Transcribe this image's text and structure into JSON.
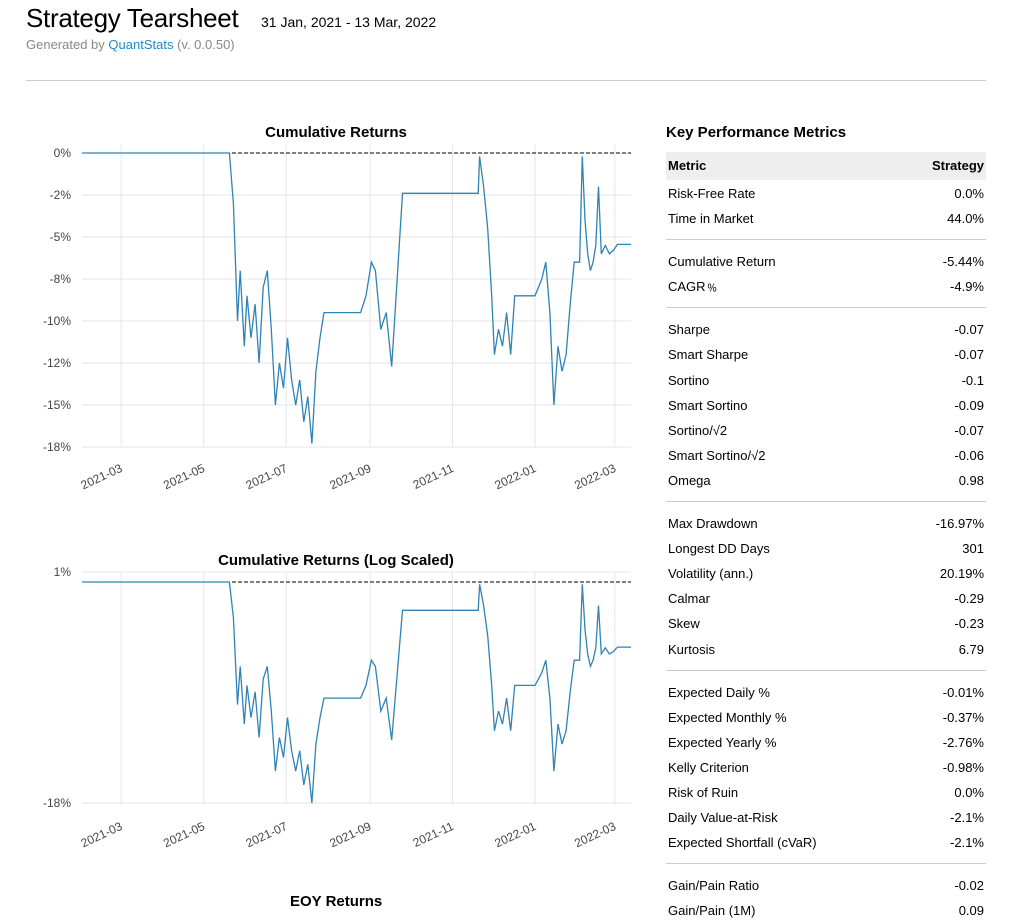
{
  "header": {
    "title": "Strategy Tearsheet",
    "date_range": "31 Jan, 2021 - 13 Mar, 2022",
    "generated_prefix": "Generated by",
    "generated_link": "QuantStats",
    "generated_version": "(v. 0.0.50)"
  },
  "colors": {
    "line": "#2f83b5",
    "link": "#1f8bc2",
    "header_bg": "#eeeeee"
  },
  "chart_data": [
    {
      "type": "line",
      "title": "Cumulative Returns",
      "x_ticks": [
        "2021-03",
        "2021-05",
        "2021-07",
        "2021-09",
        "2021-11",
        "2022-01",
        "2022-03"
      ],
      "y_ticks": [
        "0%",
        "-2%",
        "-5%",
        "-8%",
        "-10%",
        "-12%",
        "-15%",
        "-18%"
      ],
      "xlim": [
        "2021-01-31",
        "2022-03-13"
      ],
      "ylim": [
        -17.5,
        0
      ],
      "grid": true,
      "reference_line": 0,
      "series": [
        {
          "x": [
            "2021-01-31",
            "2021-05-20",
            "2021-05-23",
            "2021-05-26",
            "2021-05-28",
            "2021-05-31",
            "2021-06-02",
            "2021-06-05",
            "2021-06-08",
            "2021-06-11",
            "2021-06-14",
            "2021-06-17",
            "2021-06-20",
            "2021-06-23",
            "2021-06-26",
            "2021-06-29",
            "2021-07-02",
            "2021-07-05",
            "2021-07-08",
            "2021-07-11",
            "2021-07-14",
            "2021-07-17",
            "2021-07-20",
            "2021-07-23",
            "2021-07-26",
            "2021-07-29",
            "2021-08-25",
            "2021-08-29",
            "2021-09-02",
            "2021-09-05",
            "2021-09-09",
            "2021-09-13",
            "2021-09-17",
            "2021-09-25",
            "2021-11-20",
            "2021-11-21",
            "2021-11-24",
            "2021-11-27",
            "2021-11-30",
            "2021-12-02",
            "2021-12-05",
            "2021-12-08",
            "2021-12-11",
            "2021-12-14",
            "2021-12-17",
            "2021-12-20",
            "2022-01-01",
            "2022-01-06",
            "2022-01-09",
            "2022-01-12",
            "2022-01-15",
            "2022-01-18",
            "2022-01-21",
            "2022-01-24",
            "2022-01-27",
            "2022-01-30",
            "2022-02-01",
            "2022-02-03",
            "2022-02-05",
            "2022-02-07",
            "2022-02-09",
            "2022-02-11",
            "2022-02-13",
            "2022-02-15",
            "2022-02-17",
            "2022-02-19",
            "2022-02-22",
            "2022-02-25",
            "2022-02-28",
            "2022-03-03",
            "2022-03-06",
            "2022-03-09",
            "2022-03-11",
            "2022-03-13"
          ],
          "y": [
            0,
            0,
            -3.0,
            -10.0,
            -7.0,
            -11.5,
            -8.5,
            -11.0,
            -9.0,
            -12.5,
            -8.0,
            -7.0,
            -10.5,
            -15.0,
            -12.5,
            -14.0,
            -11.0,
            -13.5,
            -15.0,
            -13.5,
            -16.0,
            -14.5,
            -17.3,
            -13.0,
            -11.0,
            -9.5,
            -9.5,
            -8.5,
            -6.5,
            -7.0,
            -10.5,
            -9.5,
            -12.7,
            -2.4,
            -2.4,
            -0.2,
            -2.0,
            -4.5,
            -8.5,
            -12.0,
            -10.5,
            -11.5,
            -9.5,
            -12.0,
            -8.5,
            -8.5,
            -8.5,
            -7.5,
            -6.5,
            -9.5,
            -15.0,
            -11.5,
            -13.0,
            -12.0,
            -9.0,
            -6.5,
            -6.5,
            -6.5,
            -0.2,
            -4.0,
            -6.0,
            -7.0,
            -6.5,
            -5.5,
            -2.0,
            -6.0,
            -5.5,
            -6.0,
            -5.8,
            -5.44,
            -5.44,
            -5.44,
            -5.44,
            -5.44
          ]
        }
      ]
    },
    {
      "type": "line",
      "title": "Cumulative Returns (Log Scaled)",
      "x_ticks": [
        "2021-03",
        "2021-05",
        "2021-07",
        "2021-09",
        "2021-11",
        "2022-01",
        "2022-03"
      ],
      "y_ticks": [
        "1%",
        "-18%"
      ],
      "xlim": [
        "2021-01-31",
        "2022-03-13"
      ],
      "y_scale": "log",
      "grid": true,
      "reference_line": 0
    }
  ],
  "metrics": {
    "title": "Key Performance Metrics",
    "header": [
      "Metric",
      "Strategy"
    ],
    "groups": [
      [
        [
          "Risk-Free Rate",
          "0.0%"
        ],
        [
          "Time in Market",
          "44.0%"
        ]
      ],
      [
        [
          "Cumulative Return",
          "-5.44%"
        ],
        [
          "CAGR﹪",
          "-4.9%"
        ]
      ],
      [
        [
          "Sharpe",
          "-0.07"
        ],
        [
          "Smart Sharpe",
          "-0.07"
        ],
        [
          "Sortino",
          "-0.1"
        ],
        [
          "Smart Sortino",
          "-0.09"
        ],
        [
          "Sortino/√2",
          "-0.07"
        ],
        [
          "Smart Sortino/√2",
          "-0.06"
        ],
        [
          "Omega",
          "0.98"
        ]
      ],
      [
        [
          "Max Drawdown",
          "-16.97%"
        ],
        [
          "Longest DD Days",
          "301"
        ],
        [
          "Volatility (ann.)",
          "20.19%"
        ],
        [
          "Calmar",
          "-0.29"
        ],
        [
          "Skew",
          "-0.23"
        ],
        [
          "Kurtosis",
          "6.79"
        ]
      ],
      [
        [
          "Expected Daily %",
          "-0.01%"
        ],
        [
          "Expected Monthly %",
          "-0.37%"
        ],
        [
          "Expected Yearly %",
          "-2.76%"
        ],
        [
          "Kelly Criterion",
          "-0.98%"
        ],
        [
          "Risk of Ruin",
          "0.0%"
        ],
        [
          "Daily Value-at-Risk",
          "-2.1%"
        ],
        [
          "Expected Shortfall (cVaR)",
          "-2.1%"
        ]
      ],
      [
        [
          "Gain/Pain Ratio",
          "-0.02"
        ],
        [
          "Gain/Pain (1M)",
          "0.09"
        ]
      ]
    ]
  },
  "eoy": {
    "title": "EOY Returns"
  }
}
